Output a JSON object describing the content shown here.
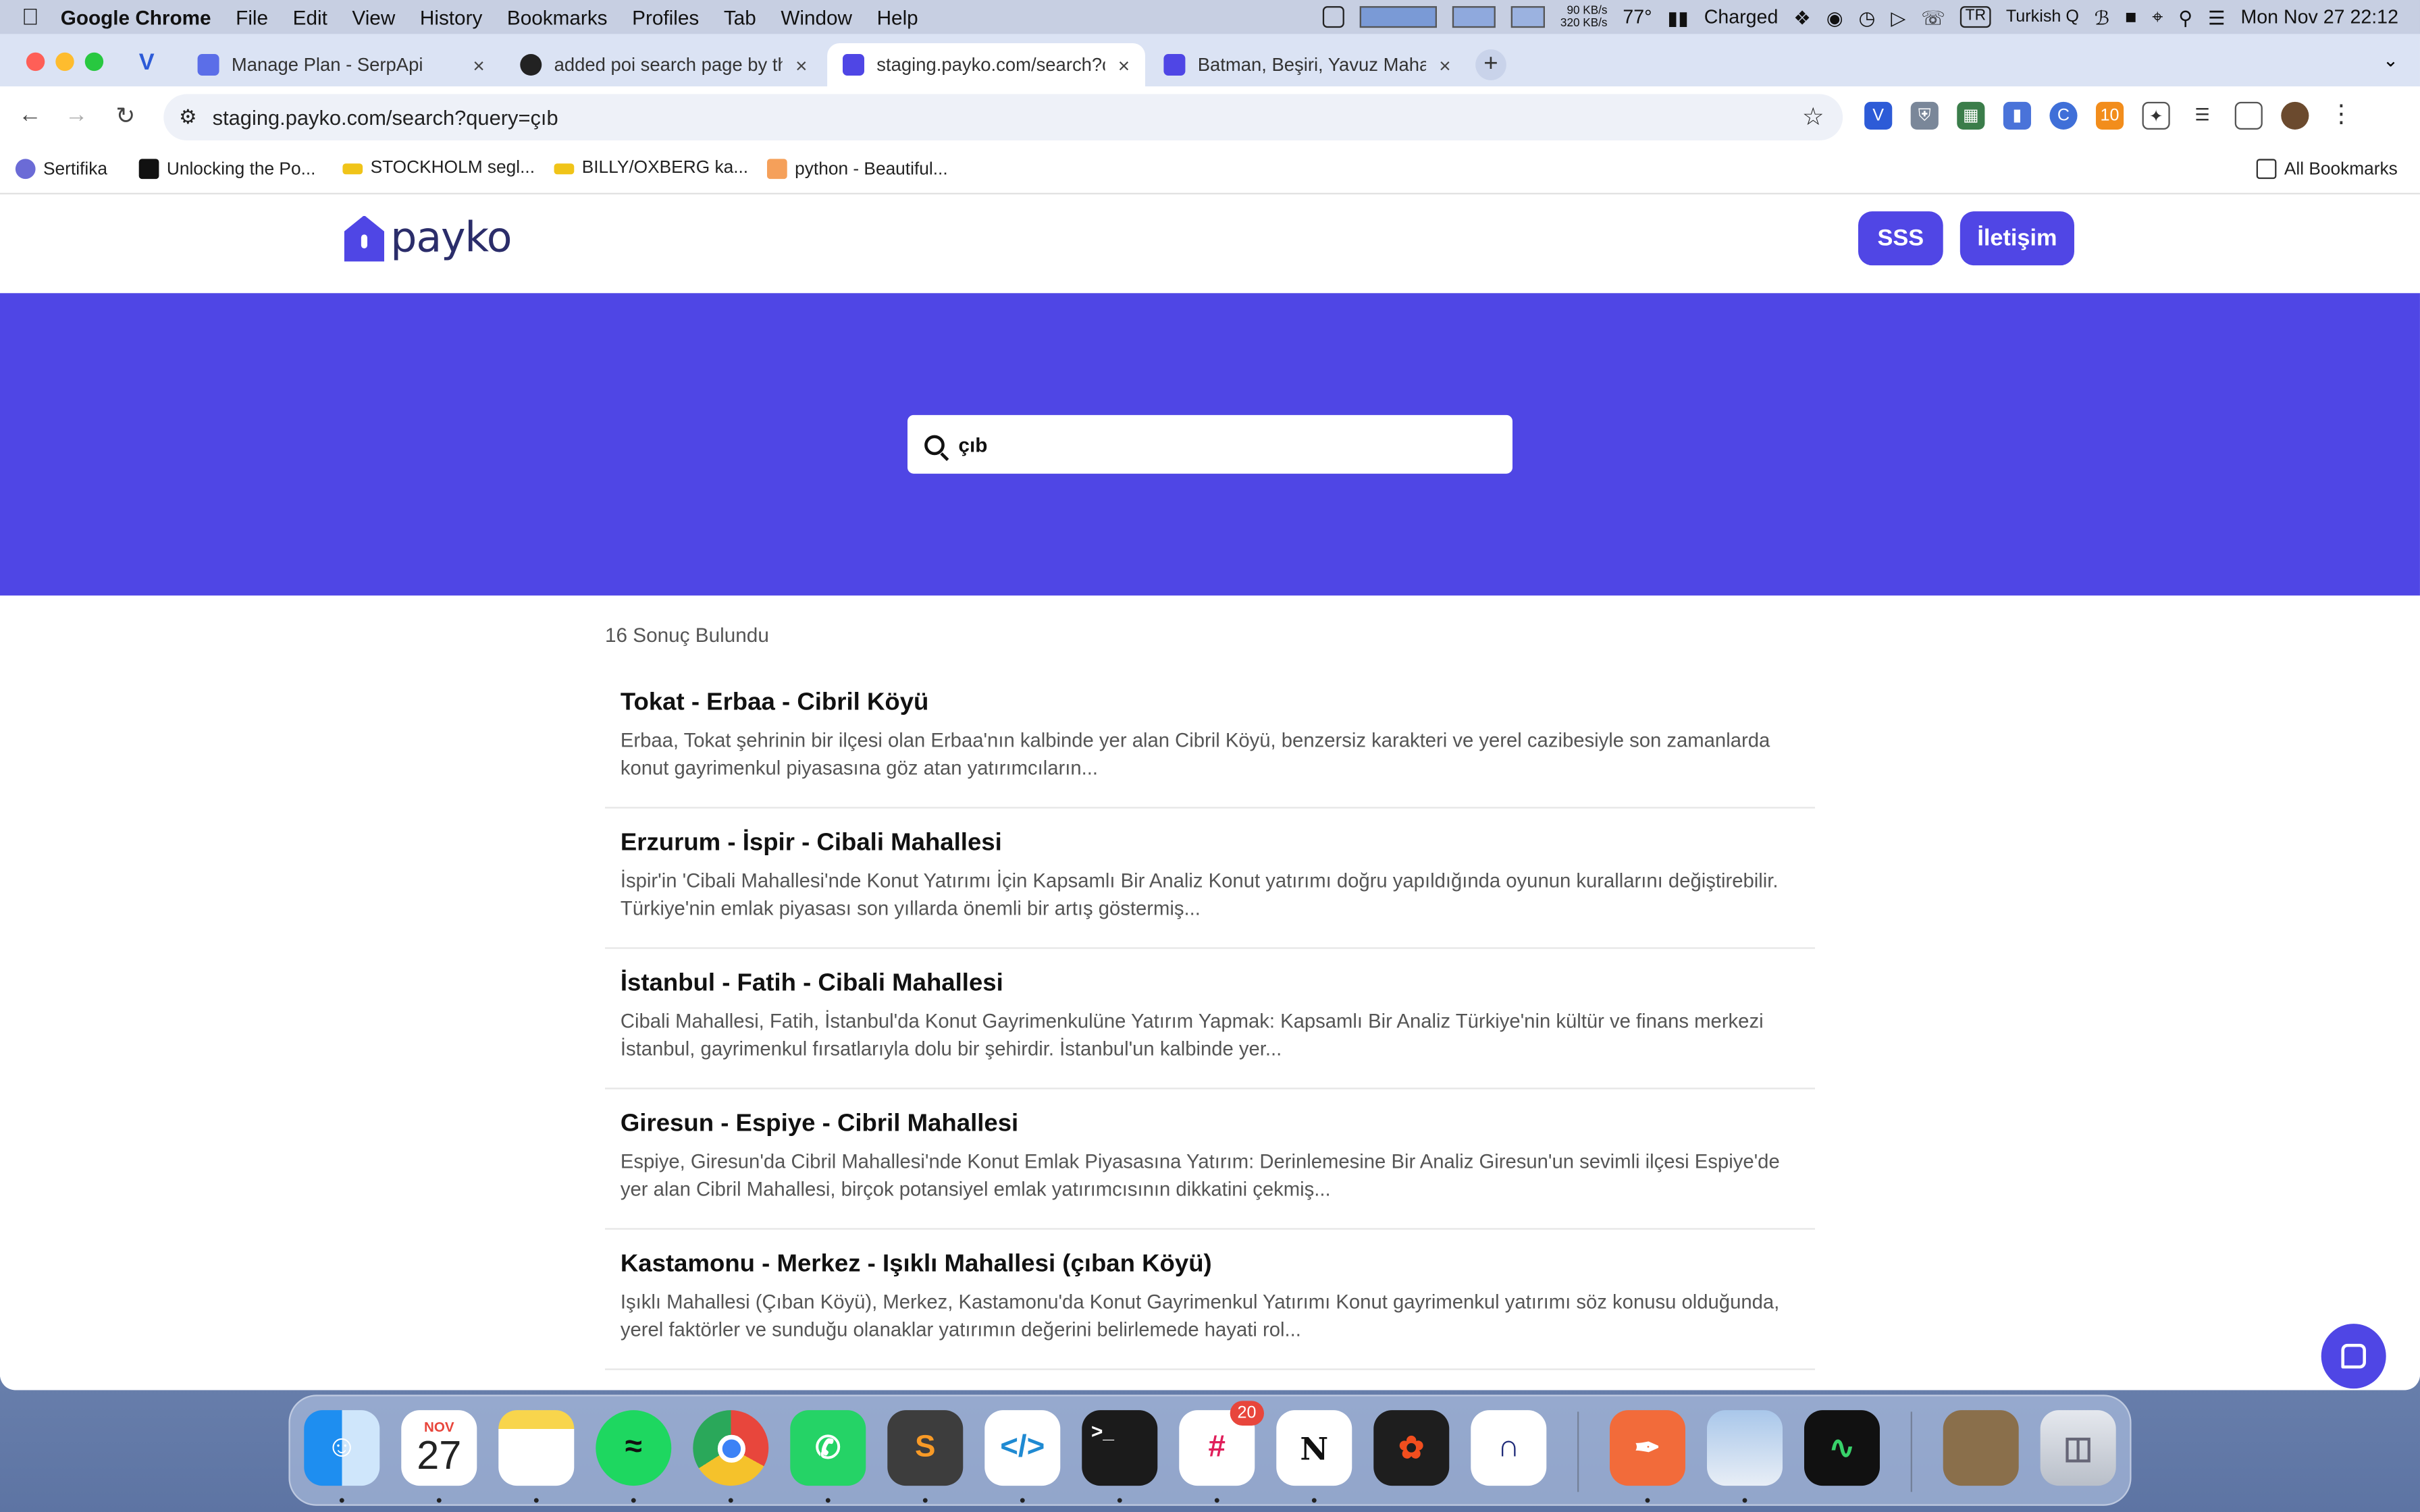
{
  "menubar": {
    "app": "Google Chrome",
    "menus": [
      "File",
      "Edit",
      "View",
      "History",
      "Bookmarks",
      "Profiles",
      "Tab",
      "Window",
      "Help"
    ],
    "net_up": "90 KB/s",
    "net_down": "320 KB/s",
    "temp": "77°",
    "battery": "Charged",
    "input_source_code": "TR",
    "input_source": "Turkish Q",
    "datetime": "Mon Nov 27  22:12"
  },
  "tabs": [
    {
      "title": "Manage Plan - SerpApi",
      "close": "×",
      "color": "#5b6ee8"
    },
    {
      "title": "added poi search page by th",
      "close": "×",
      "color": "#222222"
    },
    {
      "title": "staging.payko.com/search?q",
      "close": "×",
      "color": "#4f46e5"
    },
    {
      "title": "Batman, Beşiri, Yavuz Mahalle",
      "close": "×",
      "color": "#4f46e5"
    }
  ],
  "toolbar": {
    "url": "staging.payko.com/search?query=çıb"
  },
  "bookmarks": [
    "Sertifika",
    "Unlocking the Po...",
    "STOCKHOLM segl...",
    "BILLY/OXBERG ka...",
    "python - Beautiful..."
  ],
  "all_bookmarks": "All Bookmarks",
  "site": {
    "logo": "payko",
    "nav": [
      "SSS",
      "İletişim"
    ],
    "search_value": "çıb",
    "result_count": "16 Sonuç Bulundu",
    "results": [
      {
        "title": "Tokat - Erbaa - Cibril Köyü",
        "snippet": "Erbaa, Tokat şehrinin bir ilçesi olan Erbaa'nın kalbinde yer alan Cibril Köyü, benzersiz karakteri ve yerel cazibesiyle son zamanlarda konut gayrimenkul piyasasına göz atan yatırımcıların..."
      },
      {
        "title": "Erzurum - İspir - Cibali Mahallesi",
        "snippet": "İspir'in 'Cibali Mahallesi'nde Konut Yatırımı İçin Kapsamlı Bir Analiz Konut yatırımı doğru yapıldığında oyunun kurallarını değiştirebilir. Türkiye'nin emlak piyasası son yıllarda önemli bir artış göstermiş..."
      },
      {
        "title": "İstanbul - Fatih - Cibali Mahallesi",
        "snippet": "Cibali Mahallesi, Fatih, İstanbul'da Konut Gayrimenkulüne Yatırım Yapmak: Kapsamlı Bir Analiz Türkiye'nin kültür ve finans merkezi İstanbul, gayrimenkul fırsatlarıyla dolu bir şehirdir. İstanbul'un kalbinde yer..."
      },
      {
        "title": "Giresun - Espiye - Cibril Mahallesi",
        "snippet": "Espiye, Giresun'da Cibril Mahallesi'nde Konut Emlak Piyasasına Yatırım: Derinlemesine Bir Analiz Giresun'un sevimli ilçesi Espiye'de yer alan Cibril Mahallesi, birçok potansiyel emlak yatırımcısının dikkatini çekmiş..."
      },
      {
        "title": "Kastamonu - Merkez - Işıklı Mahallesi (çıban Köyü)",
        "snippet": "Işıklı Mahallesi (Çıban Köyü), Merkez, Kastamonu'da Konut Gayrimenkul Yatırımı Konut gayrimenkul yatırımı söz konusu olduğunda, yerel faktörler ve sunduğu olanaklar yatırımın değerini belirlemede hayati rol..."
      }
    ]
  },
  "dock": {
    "calendar_month": "NOV",
    "calendar_day": "27",
    "slack_badge": "20",
    "apps": [
      "Finder",
      "Calendar",
      "Notes",
      "Spotify",
      "Chrome",
      "WhatsApp",
      "Sublime Text",
      "VS Code",
      "Terminal",
      "Slack",
      "Notion",
      "Figma",
      "Linear",
      "Postman",
      "Preview",
      "Activity Monitor",
      "Photos",
      "Trash"
    ]
  },
  "colors": {
    "brand": "#4f46e5",
    "menubar": "#c7cfe2",
    "tabbar": "#dbe3f4"
  }
}
